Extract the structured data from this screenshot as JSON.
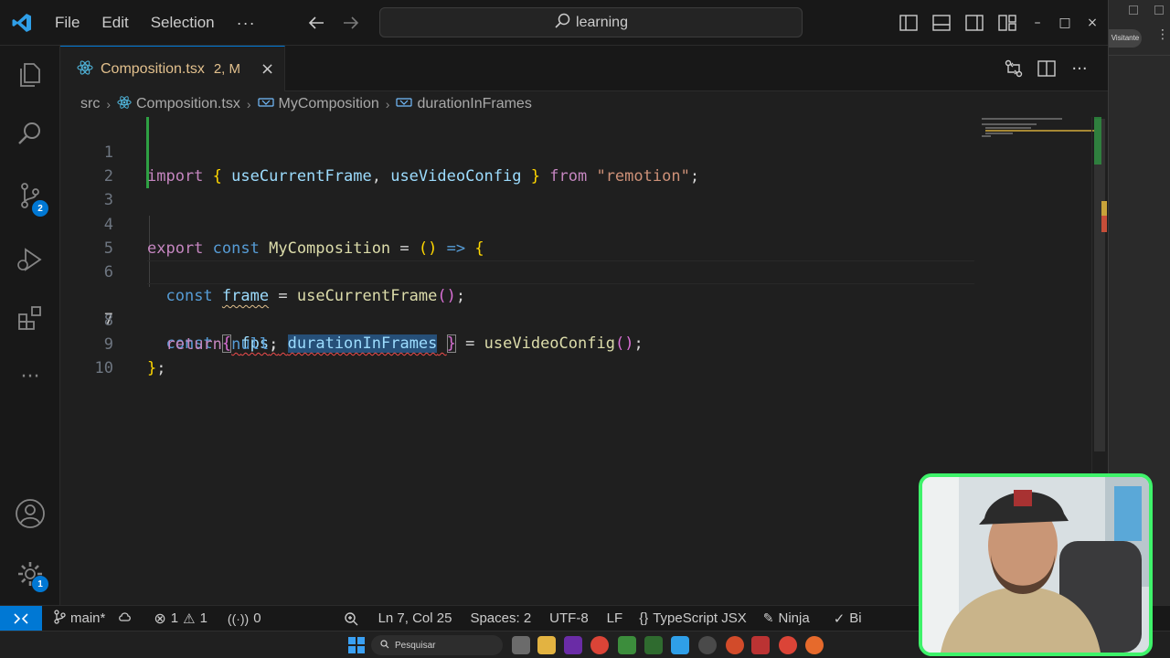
{
  "titlebar": {
    "menu": [
      "File",
      "Edit",
      "Selection"
    ],
    "more": "···",
    "search_text": "learning",
    "window_controls": {
      "minimize": "–",
      "maximize": "□",
      "close": "×"
    }
  },
  "right_window": {
    "visitor_label": "Visitante",
    "more": "⋮"
  },
  "activity": {
    "source_control_badge": "2",
    "settings_badge": "1"
  },
  "tab": {
    "filename": "Composition.tsx",
    "status": "2, M",
    "close": "×"
  },
  "breadcrumb": {
    "folder": "src",
    "file": "Composition.tsx",
    "symbol1": "MyComposition",
    "symbol2": "durationInFrames"
  },
  "code": {
    "line_numbers": [
      "1",
      "2",
      "3",
      "4",
      "5",
      "6",
      "7",
      "8",
      "9",
      "10"
    ],
    "current_line": 7
  },
  "statusbar": {
    "branch": "main*",
    "errors": "1",
    "warnings": "1",
    "ports": "0",
    "position": "Ln 7, Col 25",
    "spaces": "Spaces: 2",
    "encoding": "UTF-8",
    "eol": "LF",
    "braces": "{}",
    "language": "TypeScript JSX",
    "extension": "Ninja",
    "truncated": "Bi"
  },
  "taskbar": {
    "search_placeholder": "Pesquisar"
  },
  "colors": {
    "accent": "#0078d4",
    "modified": "#e2c08d",
    "git_added": "#2ea043",
    "webcam_border": "#3ef26a"
  }
}
